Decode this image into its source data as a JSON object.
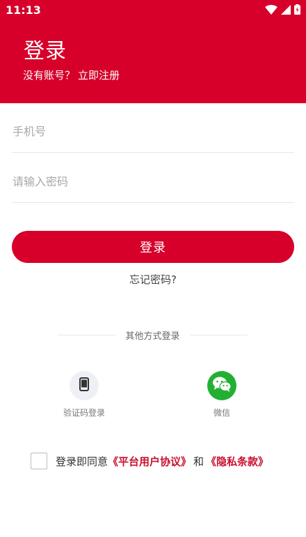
{
  "status_bar": {
    "time": "11:13",
    "icons": [
      "wifi-icon",
      "signal-icon",
      "battery-charging-icon"
    ]
  },
  "header": {
    "title": "登录",
    "prompt": "没有账号？",
    "register_link": "立即注册"
  },
  "form": {
    "phone_placeholder": "手机号",
    "phone_value": "",
    "password_placeholder": "请输入密码",
    "password_value": "",
    "login_button": "登录",
    "forgot_link": "忘记密码?"
  },
  "other_login": {
    "divider_text": "其他方式登录",
    "methods": [
      {
        "label": "验证码登录",
        "icon": "phone-icon"
      },
      {
        "label": "微信",
        "icon": "wechat-icon"
      }
    ]
  },
  "agreement": {
    "checked": false,
    "prefix": "登录即同意",
    "platform_link": "《平台用户协议》",
    "and": "和",
    "privacy_link": "《隐私条款》"
  },
  "colors": {
    "brand_red": "#d6002a",
    "link_red": "#c8102e",
    "wechat_green": "#22b033"
  }
}
